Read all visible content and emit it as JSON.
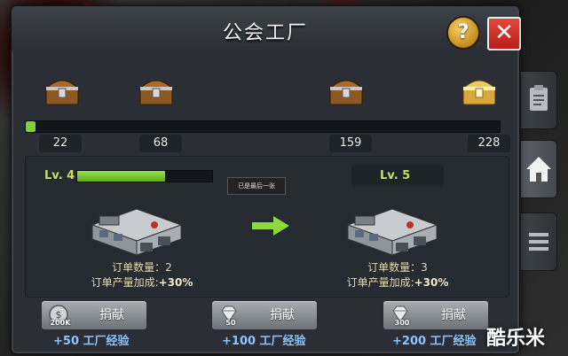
{
  "dialog": {
    "title": "公会工厂",
    "help_label": "?",
    "close_label": "✕"
  },
  "chest_track": {
    "progress": 0.02,
    "milestones": [
      "22",
      "68",
      "159",
      "228"
    ],
    "chests": [
      "bronze-chest",
      "bronze-chest",
      "bronze-chest",
      "gold-chest"
    ]
  },
  "current_level": {
    "label": "Lv. 4",
    "progress": 0.65,
    "order_count": "订单数量：2",
    "order_bonus_prefix": "订单产量加成:",
    "order_bonus_value": "+30%"
  },
  "next_level": {
    "label": "Lv. 5",
    "order_count": "订单数量：3",
    "order_bonus_prefix": "订单产量加成:",
    "order_bonus_value": "+30%"
  },
  "toast": "已是最后一张",
  "donate_buttons": [
    {
      "label": "捐献",
      "cost": "200K",
      "cost_icon": "coin-icon",
      "exp": "+50 工厂经验"
    },
    {
      "label": "捐献",
      "cost": "50",
      "cost_icon": "diamond-icon",
      "exp": "+100 工厂经验"
    },
    {
      "label": "捐献",
      "cost": "300",
      "cost_icon": "diamond-icon",
      "exp": "+200 工厂经验"
    }
  ],
  "side_tabs": [
    "clipboard-icon",
    "home-icon",
    "menu-icon"
  ],
  "watermark": "酷乐米",
  "colors": {
    "progress_green": "#7fd13a",
    "level_text": "#c9e05a",
    "exp_text": "#8fc3ff",
    "close_red": "#d6352b",
    "help_gold": "#e3a838"
  }
}
